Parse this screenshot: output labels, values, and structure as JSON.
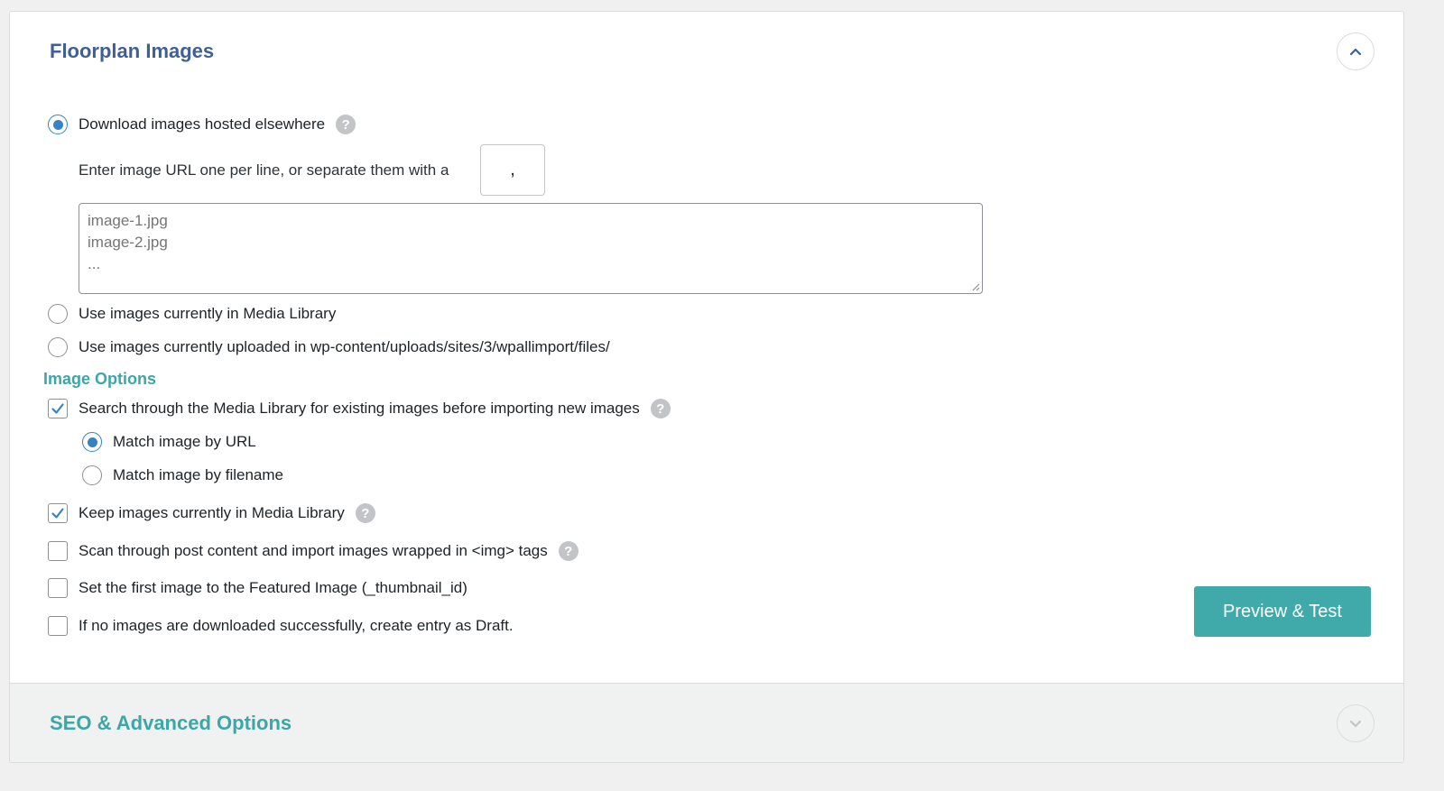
{
  "panel": {
    "title": "Floorplan Images",
    "collapse_icon": "chevron-up-icon"
  },
  "download": {
    "radio_label": "Download images hosted elsewhere",
    "help_glyph": "?",
    "separator_text": "Enter image URL one per line, or separate them with a",
    "separator_value": ",",
    "urls_placeholder": "image-1.jpg\nimage-2.jpg\n..."
  },
  "media_library": {
    "radio_label": "Use images currently in Media Library"
  },
  "uploaded": {
    "radio_label": "Use images currently uploaded in wp-content/uploads/sites/3/wpallimport/files/"
  },
  "image_options": {
    "heading": "Image Options",
    "search_label": "Search through the Media Library for existing images before importing new images",
    "match_url_label": "Match image by URL",
    "match_filename_label": "Match image by filename",
    "keep_label": "Keep images currently in Media Library",
    "scan_label": "Scan through post content and import images wrapped in <img> tags",
    "featured_label": "Set the first image to the Featured Image (_thumbnail_id)",
    "draft_label": "If no images are downloaded successfully, create entry as Draft."
  },
  "preview_button": "Preview & Test",
  "seo": {
    "title": "SEO & Advanced Options",
    "expand_icon": "chevron-down-icon"
  },
  "colors": {
    "accent_teal": "#40aaaa",
    "title_blue": "#3f5f96",
    "radio_blue": "#3582c4"
  }
}
